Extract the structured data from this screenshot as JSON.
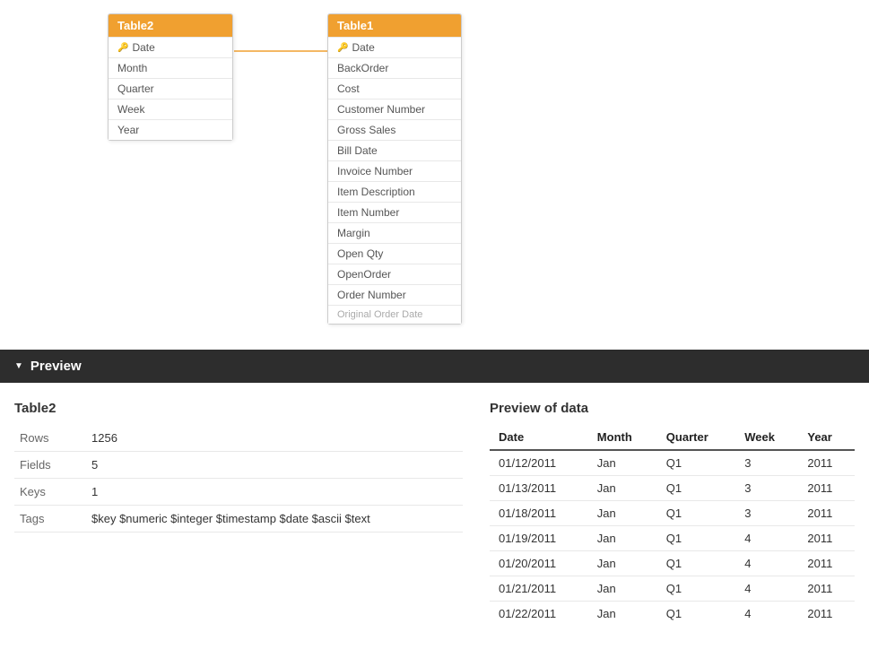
{
  "diagram": {
    "table2": {
      "title": "Table2",
      "fields": [
        {
          "name": "Date",
          "isKey": true
        },
        {
          "name": "Month",
          "isKey": false
        },
        {
          "name": "Quarter",
          "isKey": false
        },
        {
          "name": "Week",
          "isKey": false
        },
        {
          "name": "Year",
          "isKey": false
        }
      ]
    },
    "table1": {
      "title": "Table1",
      "fields": [
        {
          "name": "Date",
          "isKey": true
        },
        {
          "name": "BackOrder",
          "isKey": false
        },
        {
          "name": "Cost",
          "isKey": false
        },
        {
          "name": "Customer Number",
          "isKey": false
        },
        {
          "name": "Gross Sales",
          "isKey": false
        },
        {
          "name": "Bill Date",
          "isKey": false
        },
        {
          "name": "Invoice Number",
          "isKey": false
        },
        {
          "name": "Item Description",
          "isKey": false
        },
        {
          "name": "Item Number",
          "isKey": false
        },
        {
          "name": "Margin",
          "isKey": false
        },
        {
          "name": "Open Qty",
          "isKey": false
        },
        {
          "name": "OpenOrder",
          "isKey": false
        },
        {
          "name": "Order Number",
          "isKey": false
        },
        {
          "name": "Original Order Date",
          "isKey": false
        }
      ]
    }
  },
  "preview": {
    "section_label": "Preview",
    "meta": {
      "title": "Table2",
      "rows_label": "Rows",
      "rows_value": "1256",
      "fields_label": "Fields",
      "fields_value": "5",
      "keys_label": "Keys",
      "keys_value": "1",
      "tags_label": "Tags",
      "tags_value": "$key $numeric $integer $timestamp $date $ascii $text"
    },
    "data": {
      "title": "Preview of data",
      "columns": [
        "Date",
        "Month",
        "Quarter",
        "Week",
        "Year"
      ],
      "rows": [
        [
          "01/12/2011",
          "Jan",
          "Q1",
          "3",
          "2011"
        ],
        [
          "01/13/2011",
          "Jan",
          "Q1",
          "3",
          "2011"
        ],
        [
          "01/18/2011",
          "Jan",
          "Q1",
          "3",
          "2011"
        ],
        [
          "01/19/2011",
          "Jan",
          "Q1",
          "4",
          "2011"
        ],
        [
          "01/20/2011",
          "Jan",
          "Q1",
          "4",
          "2011"
        ],
        [
          "01/21/2011",
          "Jan",
          "Q1",
          "4",
          "2011"
        ],
        [
          "01/22/2011",
          "Jan",
          "Q1",
          "4",
          "2011"
        ]
      ]
    }
  }
}
